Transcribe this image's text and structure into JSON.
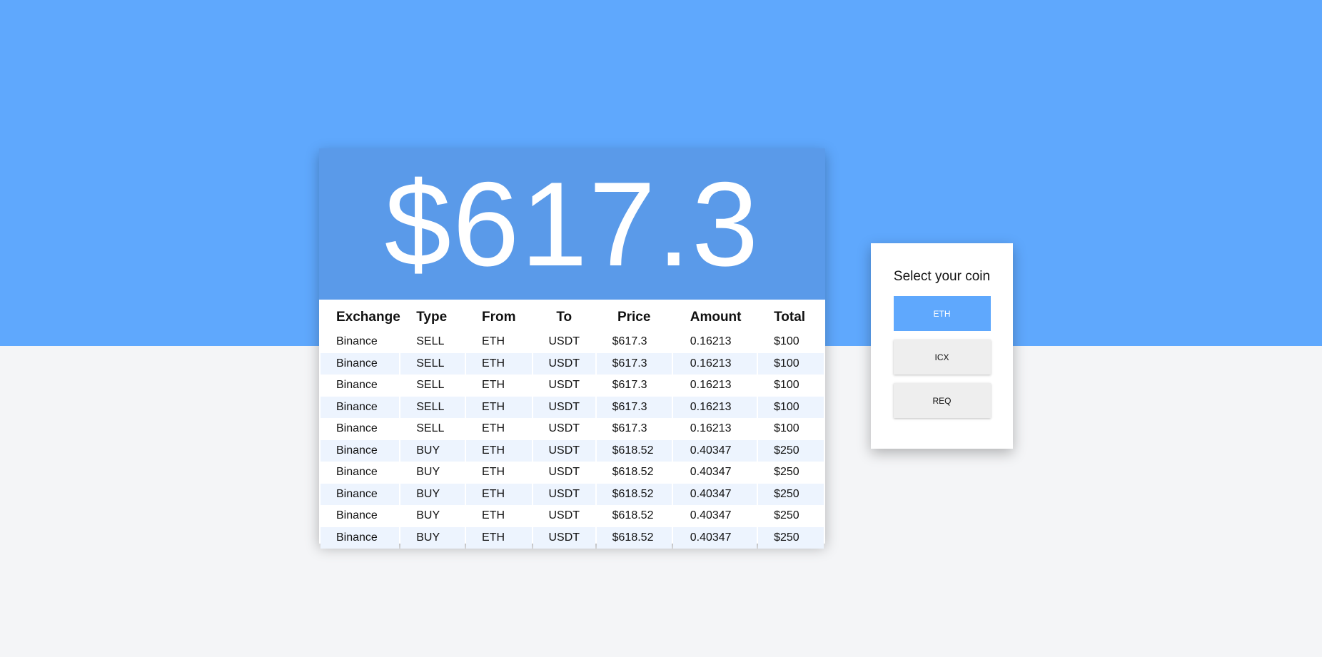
{
  "colors": {
    "top_band": "#5fa8fd",
    "price_header": "#5a9ae9",
    "page_bg": "#f4f5f7",
    "alt_row": "#edf4fe",
    "active_button": "#5fa8fd"
  },
  "price": "$617.3",
  "table": {
    "headers": {
      "exchange": "Exchange",
      "type": "Type",
      "from": "From",
      "to": "To",
      "price": "Price",
      "amount": "Amount",
      "total": "Total"
    },
    "rows": [
      {
        "exchange": "Binance",
        "type": "SELL",
        "from": "ETH",
        "to": "USDT",
        "price": "$617.3",
        "amount": "0.16213",
        "total": "$100"
      },
      {
        "exchange": "Binance",
        "type": "SELL",
        "from": "ETH",
        "to": "USDT",
        "price": "$617.3",
        "amount": "0.16213",
        "total": "$100"
      },
      {
        "exchange": "Binance",
        "type": "SELL",
        "from": "ETH",
        "to": "USDT",
        "price": "$617.3",
        "amount": "0.16213",
        "total": "$100"
      },
      {
        "exchange": "Binance",
        "type": "SELL",
        "from": "ETH",
        "to": "USDT",
        "price": "$617.3",
        "amount": "0.16213",
        "total": "$100"
      },
      {
        "exchange": "Binance",
        "type": "SELL",
        "from": "ETH",
        "to": "USDT",
        "price": "$617.3",
        "amount": "0.16213",
        "total": "$100"
      },
      {
        "exchange": "Binance",
        "type": "BUY",
        "from": "ETH",
        "to": "USDT",
        "price": "$618.52",
        "amount": "0.40347",
        "total": "$250"
      },
      {
        "exchange": "Binance",
        "type": "BUY",
        "from": "ETH",
        "to": "USDT",
        "price": "$618.52",
        "amount": "0.40347",
        "total": "$250"
      },
      {
        "exchange": "Binance",
        "type": "BUY",
        "from": "ETH",
        "to": "USDT",
        "price": "$618.52",
        "amount": "0.40347",
        "total": "$250"
      },
      {
        "exchange": "Binance",
        "type": "BUY",
        "from": "ETH",
        "to": "USDT",
        "price": "$618.52",
        "amount": "0.40347",
        "total": "$250"
      },
      {
        "exchange": "Binance",
        "type": "BUY",
        "from": "ETH",
        "to": "USDT",
        "price": "$618.52",
        "amount": "0.40347",
        "total": "$250"
      }
    ]
  },
  "coin_selector": {
    "title": "Select your coin",
    "coins": [
      {
        "label": "ETH",
        "selected": true
      },
      {
        "label": "ICX",
        "selected": false
      },
      {
        "label": "REQ",
        "selected": false
      }
    ]
  }
}
